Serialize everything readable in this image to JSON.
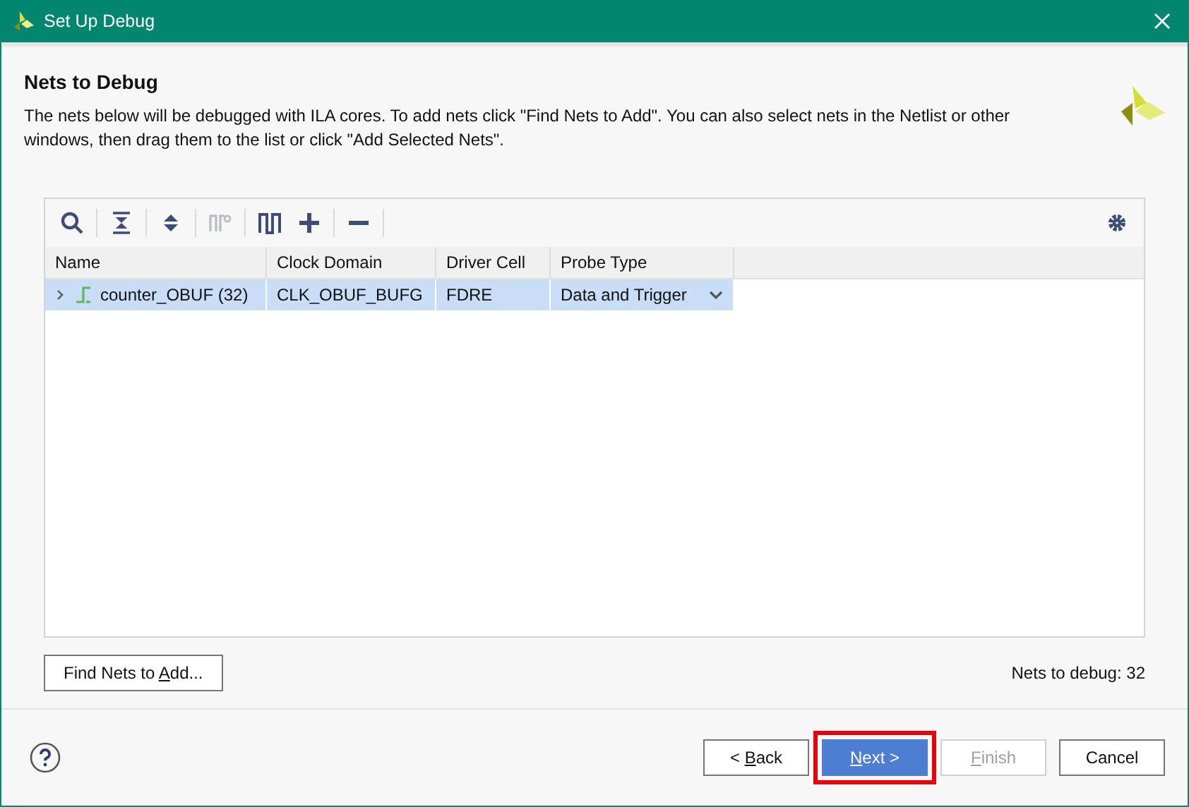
{
  "window": {
    "title": "Set Up Debug"
  },
  "header": {
    "title": "Nets to Debug",
    "description": "The nets below will be debugged with ILA cores. To add nets click \"Find Nets to Add\". You can also select nets in the Netlist or other windows, then drag them to the list or click \"Add Selected Nets\"."
  },
  "toolbar": [
    {
      "kind": "search",
      "disabled": false
    },
    {
      "kind": "collapse",
      "disabled": false
    },
    {
      "kind": "expand",
      "disabled": false
    },
    {
      "kind": "probe",
      "disabled": true
    },
    {
      "kind": "pulse",
      "disabled": false
    },
    {
      "kind": "add",
      "disabled": false
    },
    {
      "kind": "remove",
      "disabled": false
    },
    {
      "kind": "settings",
      "disabled": false
    }
  ],
  "table": {
    "columns": [
      "Name",
      "Clock Domain",
      "Driver Cell",
      "Probe Type"
    ],
    "rows": [
      {
        "name": "counter_OBUF (32)",
        "clock_domain": "CLK_OBUF_BUFG",
        "driver_cell": "FDRE",
        "probe_type": "Data and Trigger",
        "expanded": false,
        "selected": true
      }
    ]
  },
  "find_button": {
    "before": "Find Nets to ",
    "mnemonic": "A",
    "after": "dd..."
  },
  "nets_count": "Nets to debug: 32",
  "buttons": [
    {
      "before": "< ",
      "mnemonic": "B",
      "after": "ack",
      "primary": false,
      "disabled": false,
      "highlighted": false
    },
    {
      "mnemonic": "N",
      "after": "ext >",
      "primary": true,
      "disabled": false,
      "highlighted": true
    },
    {
      "mnemonic": "F",
      "after": "inish",
      "primary": false,
      "disabled": true,
      "highlighted": false
    },
    {
      "before": "Cancel",
      "primary": false,
      "disabled": false,
      "highlighted": false
    }
  ]
}
